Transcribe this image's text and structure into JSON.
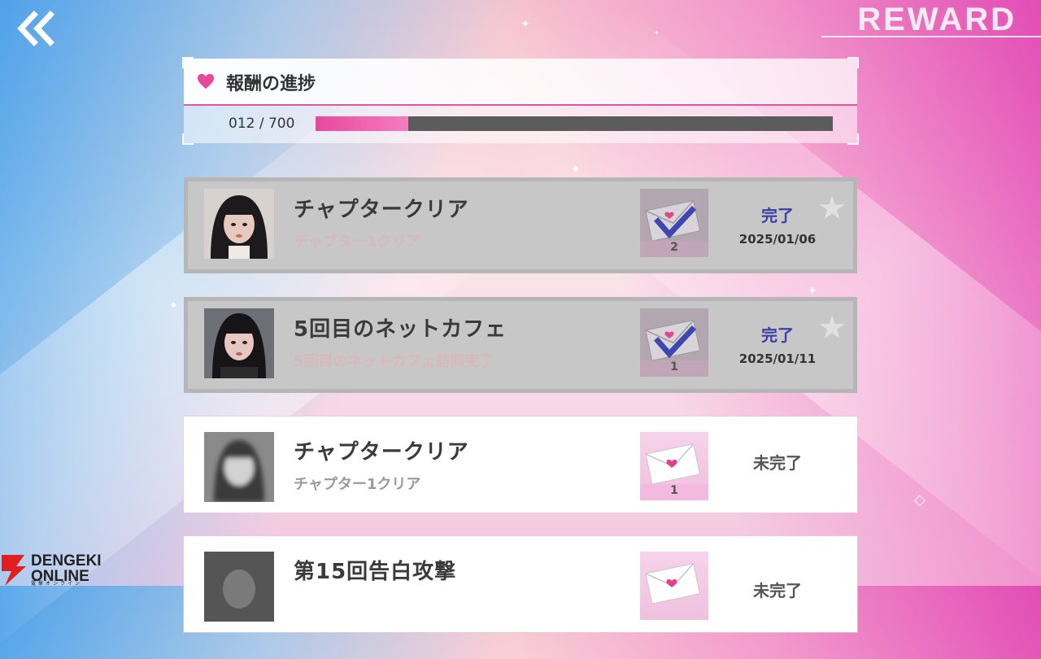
{
  "header": {
    "title": "REWARD",
    "back_icon": "double-chevron-left-icon"
  },
  "progress": {
    "title": "報酬の進捗",
    "count_text": "012 / 700",
    "current": 12,
    "total": 700,
    "fill_fraction": 0.18,
    "accent_color": "#e8489c"
  },
  "rewards": [
    {
      "title": "チャプタークリア",
      "subtitle": "チャプター1クリア",
      "reward_qty": "2",
      "status": "完了",
      "date": "2025/01/06",
      "completed": true
    },
    {
      "title": "5回目のネットカフェ",
      "subtitle": "5回目のネットカフェ訪問完了",
      "reward_qty": "1",
      "status": "完了",
      "date": "2025/01/11",
      "completed": true
    },
    {
      "title": "チャプタークリア",
      "subtitle": "チャプター1クリア",
      "reward_qty": "1",
      "status": "未完了",
      "date": "",
      "completed": false
    },
    {
      "title": "第15回告白攻撃",
      "subtitle": "",
      "reward_qty": "",
      "status": "未完了",
      "date": "",
      "completed": false
    }
  ],
  "watermark": {
    "brand_line1": "DENGEKI",
    "brand_line2": "ONLINE",
    "brand_sub": "電撃オンライン"
  }
}
